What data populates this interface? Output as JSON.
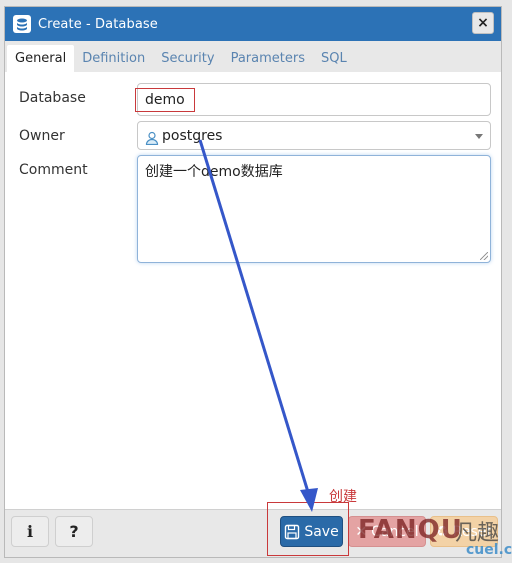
{
  "dialog": {
    "title": "Create - Database",
    "close_label": "×",
    "icons": {
      "title": "database-icon",
      "close": "close-icon"
    }
  },
  "tabs": [
    {
      "label": "General",
      "active": true
    },
    {
      "label": "Definition",
      "active": false
    },
    {
      "label": "Security",
      "active": false
    },
    {
      "label": "Parameters",
      "active": false
    },
    {
      "label": "SQL",
      "active": false
    }
  ],
  "form": {
    "database": {
      "label": "Database",
      "value": "demo"
    },
    "owner": {
      "label": "Owner",
      "value": "postgres",
      "icon": "user-icon"
    },
    "comment": {
      "label": "Comment",
      "value": "创建一个demo数据库"
    }
  },
  "footer": {
    "info_label": "i",
    "help_label": "?",
    "save_label": "Save",
    "cancel_label": "Cancel",
    "reset_label": "Reset",
    "icons": {
      "save": "floppy-disk-icon",
      "cancel": "x-icon",
      "reset": "recycle-icon"
    }
  },
  "annotation": {
    "text": "创建",
    "color": "#c9393b",
    "arrow_color": "#3557c9"
  },
  "watermark": {
    "brand": "FANQU",
    "chinese": "凡趣",
    "domain": "cuel.cn"
  }
}
